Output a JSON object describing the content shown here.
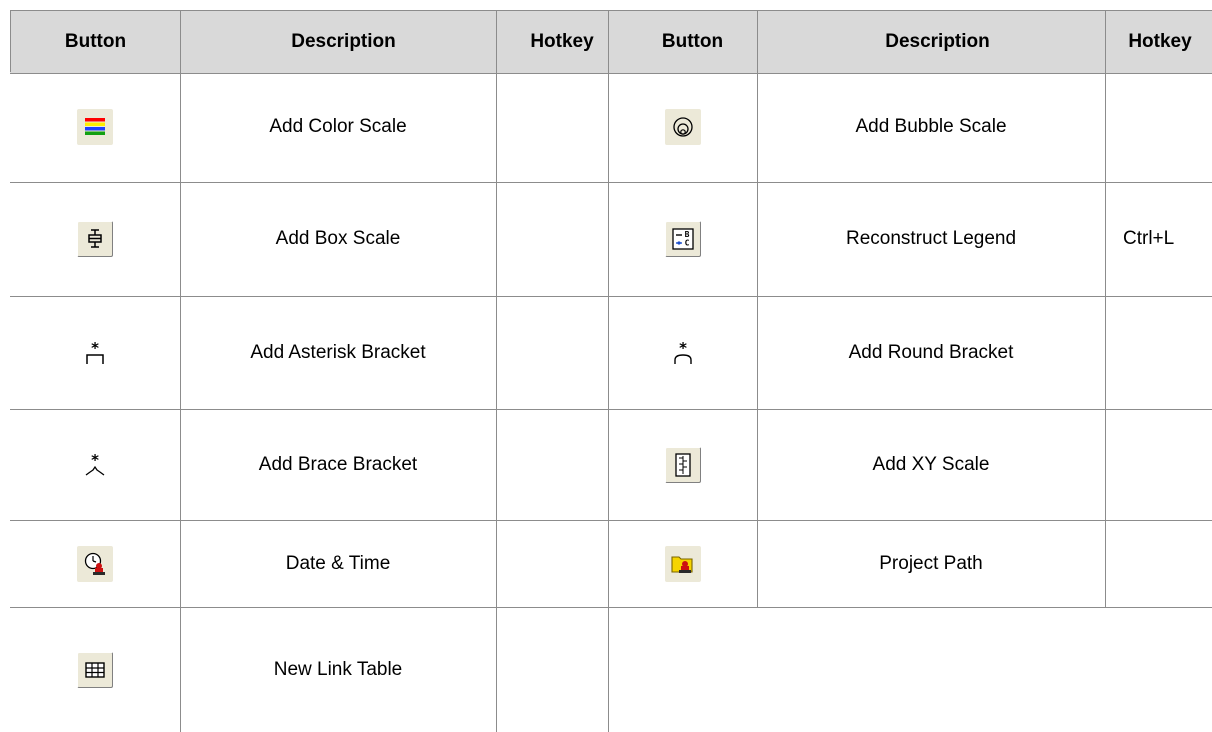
{
  "headers": {
    "left": {
      "button": "Button",
      "description": "Description",
      "hotkey": "Hotkey"
    },
    "right": {
      "button": "Button",
      "description": "Description",
      "hotkey": "Hotkey"
    }
  },
  "left_rows": [
    {
      "icon": "color-scale-icon",
      "description": "Add Color Scale",
      "hotkey": ""
    },
    {
      "icon": "box-scale-icon",
      "description": "Add Box Scale",
      "hotkey": ""
    },
    {
      "icon": "asterisk-bracket-icon",
      "description": "Add Asterisk Bracket",
      "hotkey": ""
    },
    {
      "icon": "brace-bracket-icon",
      "description": "Add Brace Bracket",
      "hotkey": ""
    },
    {
      "icon": "date-time-icon",
      "description": "Date & Time",
      "hotkey": ""
    },
    {
      "icon": "link-table-icon",
      "description": "New Link Table",
      "hotkey": ""
    }
  ],
  "right_rows": [
    {
      "icon": "bubble-scale-icon",
      "description": "Add Bubble Scale",
      "hotkey": ""
    },
    {
      "icon": "reconstruct-legend-icon",
      "description": "Reconstruct Legend",
      "hotkey": "Ctrl+L"
    },
    {
      "icon": "round-bracket-icon",
      "description": "Add Round Bracket",
      "hotkey": ""
    },
    {
      "icon": "xy-scale-icon",
      "description": "Add XY Scale",
      "hotkey": ""
    },
    {
      "icon": "project-path-icon",
      "description": "Project Path",
      "hotkey": ""
    }
  ],
  "colors": {
    "header_bg": "#d9d9d9",
    "grid_line": "#8c8c8c",
    "button_face": "#ece9d8"
  }
}
